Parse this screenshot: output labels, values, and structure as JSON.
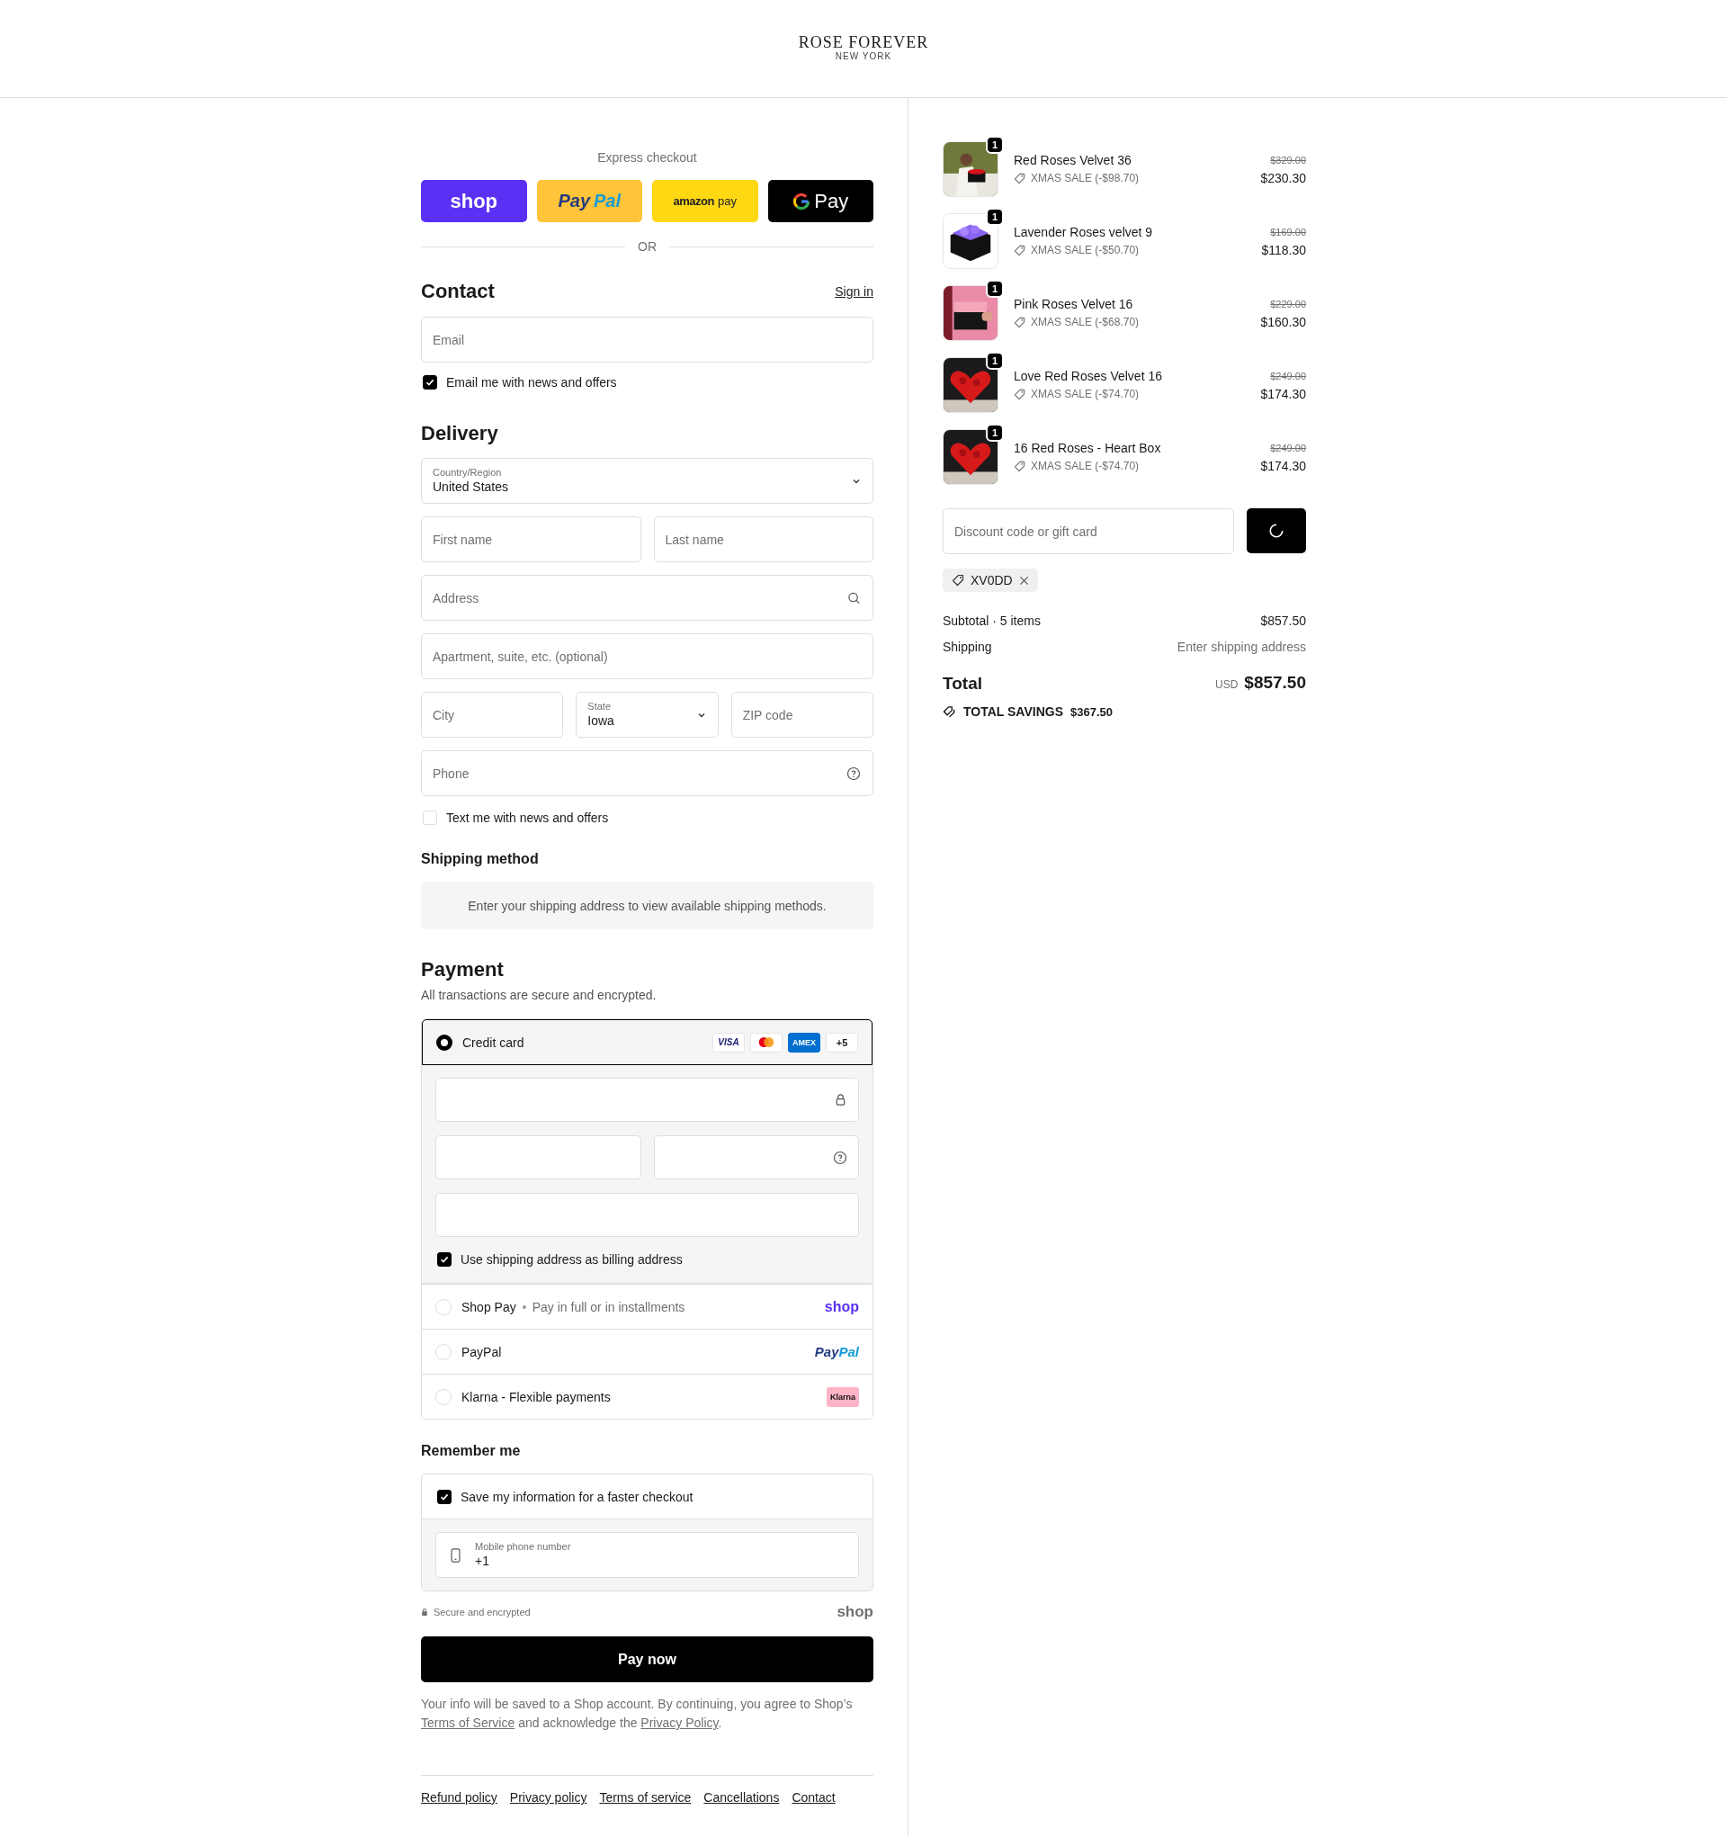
{
  "header": {
    "brand": "ROSE FOREVER",
    "location": "NEW YORK"
  },
  "express_checkout": {
    "title": "Express checkout",
    "divider": "OR",
    "buttons": [
      {
        "kind": "shop_pay",
        "parts": [
          "shop"
        ]
      },
      {
        "kind": "paypal",
        "parts": [
          "Pay",
          "Pal"
        ]
      },
      {
        "kind": "amazon_pay",
        "parts": [
          "amazon",
          "pay"
        ]
      },
      {
        "kind": "google_pay",
        "parts": [
          "Pay"
        ]
      }
    ]
  },
  "contact": {
    "heading": "Contact",
    "sign_in": "Sign in",
    "email": {
      "placeholder": "Email"
    },
    "newsletter": {
      "label": "Email me with news and offers",
      "checked": true
    }
  },
  "delivery": {
    "heading": "Delivery",
    "country": {
      "label": "Country/Region",
      "value": "United States"
    },
    "first_name": {
      "placeholder": "First name"
    },
    "last_name": {
      "placeholder": "Last name"
    },
    "address": {
      "placeholder": "Address"
    },
    "apartment": {
      "placeholder": "Apartment, suite, etc. (optional)"
    },
    "city": {
      "placeholder": "City"
    },
    "state": {
      "label": "State",
      "value": "Iowa"
    },
    "zip": {
      "placeholder": "ZIP code"
    },
    "phone": {
      "placeholder": "Phone"
    },
    "sms": {
      "label": "Text me with news and offers",
      "checked": false
    }
  },
  "shipping_method": {
    "heading": "Shipping method",
    "message": "Enter your shipping address to view available shipping methods."
  },
  "payment": {
    "heading": "Payment",
    "subtitle": "All transactions are secure and encrypted.",
    "methods": [
      {
        "kind": "card",
        "label": "Credit card",
        "selected": true,
        "badges": [
          {
            "kind": "visa",
            "text": "VISA"
          },
          {
            "kind": "mastercard"
          },
          {
            "kind": "amex",
            "text": "AMEX"
          },
          {
            "kind": "more",
            "text": "+5"
          }
        ],
        "billing_same": {
          "label": "Use shipping address as billing address",
          "checked": true
        }
      },
      {
        "kind": "shop_pay",
        "label": "Shop Pay",
        "detail": "Pay in full or in installments",
        "selected": false,
        "logo": [
          "shop"
        ]
      },
      {
        "kind": "paypal",
        "label": "PayPal",
        "selected": false,
        "logo": [
          "Pay",
          "Pal"
        ]
      },
      {
        "kind": "klarna",
        "label": "Klarna - Flexible payments",
        "selected": false,
        "logo": [
          "Klarna"
        ]
      }
    ]
  },
  "remember_me": {
    "heading": "Remember me",
    "save": {
      "label": "Save my information for a faster checkout",
      "checked": true
    },
    "phone": {
      "label": "Mobile phone number",
      "value": "+1"
    }
  },
  "secure": {
    "text": "Secure and encrypted",
    "brand": "shop"
  },
  "pay_button": "Pay now",
  "legal": {
    "text_before": "Your info will be saved to a Shop account. By continuing, you agree to Shop’s ",
    "terms_link": "Terms of Service",
    "text_middle": " and acknowledge the ",
    "privacy_link": "Privacy Policy",
    "text_after": "."
  },
  "footer_links": [
    "Refund policy",
    "Privacy policy",
    "Terms of service",
    "Cancellations",
    "Contact"
  ],
  "order_summary": {
    "items": [
      {
        "name": "Red Roses Velvet 36",
        "discount": "XMAS SALE (-$98.70)",
        "original_price": "$329.00",
        "price": "$230.30",
        "quantity": "1"
      },
      {
        "name": "Lavender Roses velvet 9",
        "discount": "XMAS SALE (-$50.70)",
        "original_price": "$169.00",
        "price": "$118.30",
        "quantity": "1"
      },
      {
        "name": "Pink Roses Velvet 16",
        "discount": "XMAS SALE (-$68.70)",
        "original_price": "$229.00",
        "price": "$160.30",
        "quantity": "1"
      },
      {
        "name": "Love Red Roses Velvet 16",
        "discount": "XMAS SALE (-$74.70)",
        "original_price": "$249.00",
        "price": "$174.30",
        "quantity": "1"
      },
      {
        "name": "16 Red Roses - Heart Box",
        "discount": "XMAS SALE (-$74.70)",
        "original_price": "$249.00",
        "price": "$174.30",
        "quantity": "1"
      }
    ],
    "discount": {
      "placeholder": "Discount code or gift card"
    },
    "applied_codes": [
      {
        "code": "XV0DD"
      }
    ],
    "subtotal": {
      "label": "Subtotal · 5 items",
      "value": "$857.50"
    },
    "shipping": {
      "label": "Shipping",
      "value": "Enter shipping address"
    },
    "total": {
      "label": "Total",
      "currency": "USD",
      "amount": "$857.50"
    },
    "savings": {
      "label": "TOTAL SAVINGS",
      "amount": "$367.50"
    }
  }
}
